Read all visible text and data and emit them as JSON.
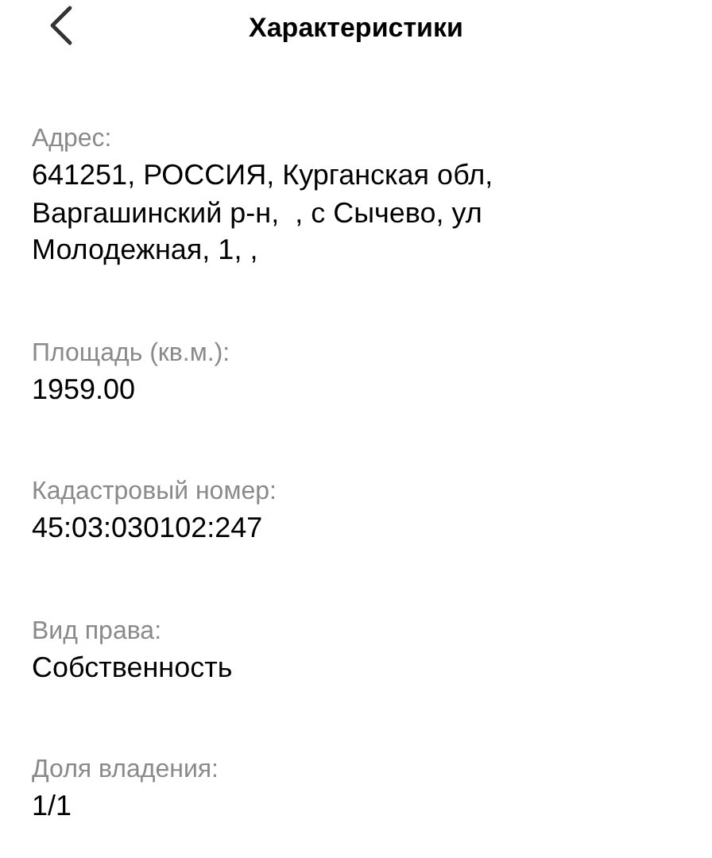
{
  "header": {
    "title": "Характеристики"
  },
  "fields": [
    {
      "label": "Адрес:",
      "value": "641251, РОССИЯ, Курганская обл, Варгашинский р-н,  , с Сычево, ул Молодежная, 1, ,"
    },
    {
      "label": "Площадь (кв.м.):",
      "value": "1959.00"
    },
    {
      "label": "Кадастровый номер:",
      "value": "45:03:030102:247"
    },
    {
      "label": "Вид права:",
      "value": "Собственность"
    },
    {
      "label": "Доля владения:",
      "value": "1/1"
    }
  ]
}
